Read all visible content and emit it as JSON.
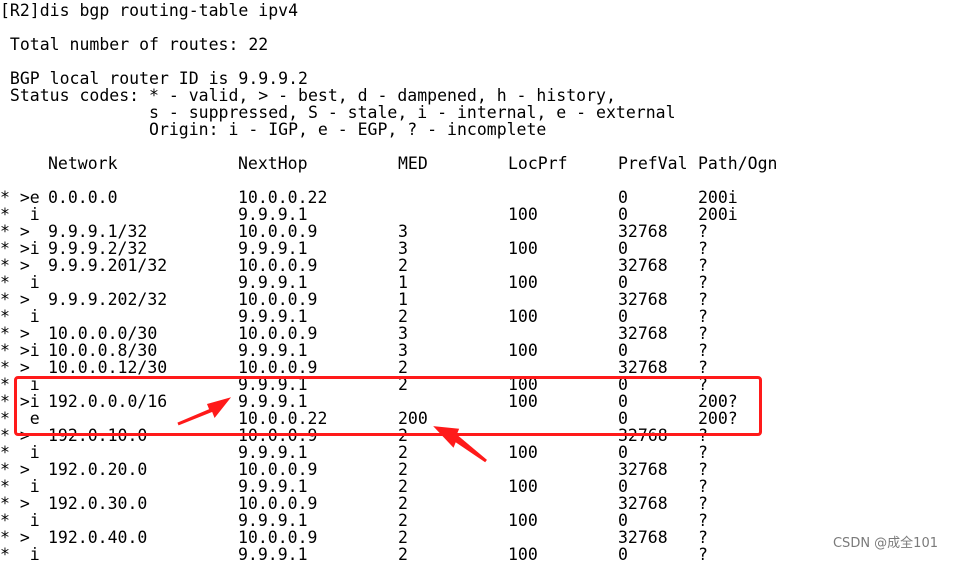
{
  "command": "[R2]dis bgp routing-table ipv4",
  "total_routes": " Total number of routes: 22",
  "router_id": " BGP local router ID is 9.9.9.2",
  "status_codes": [
    " Status codes: * - valid, > - best, d - dampened, h - history,",
    "               s - suppressed, S - stale, i - internal, e - external",
    "               Origin: i - IGP, e - EGP, ? - incomplete"
  ],
  "columns": [
    "Network",
    "NextHop",
    "MED",
    "LocPrf",
    "PrefVal",
    "Path/Ogn"
  ],
  "rows": [
    {
      "status": "* >e",
      "network": "0.0.0.0",
      "nexthop": "10.0.0.22",
      "med": "",
      "locprf": "",
      "prefval": "0",
      "path": "200i"
    },
    {
      "status": "*  i",
      "network": "",
      "nexthop": "9.9.9.1",
      "med": "",
      "locprf": "100",
      "prefval": "0",
      "path": "200i"
    },
    {
      "status": "* >",
      "network": "9.9.9.1/32",
      "nexthop": "10.0.0.9",
      "med": "3",
      "locprf": "",
      "prefval": "32768",
      "path": "?"
    },
    {
      "status": "* >i",
      "network": "9.9.9.2/32",
      "nexthop": "9.9.9.1",
      "med": "3",
      "locprf": "100",
      "prefval": "0",
      "path": "?"
    },
    {
      "status": "* >",
      "network": "9.9.9.201/32",
      "nexthop": "10.0.0.9",
      "med": "2",
      "locprf": "",
      "prefval": "32768",
      "path": "?"
    },
    {
      "status": "*  i",
      "network": "",
      "nexthop": "9.9.9.1",
      "med": "1",
      "locprf": "100",
      "prefval": "0",
      "path": "?"
    },
    {
      "status": "* >",
      "network": "9.9.9.202/32",
      "nexthop": "10.0.0.9",
      "med": "1",
      "locprf": "",
      "prefval": "32768",
      "path": "?"
    },
    {
      "status": "*  i",
      "network": "",
      "nexthop": "9.9.9.1",
      "med": "2",
      "locprf": "100",
      "prefval": "0",
      "path": "?"
    },
    {
      "status": "* >",
      "network": "10.0.0.0/30",
      "nexthop": "10.0.0.9",
      "med": "3",
      "locprf": "",
      "prefval": "32768",
      "path": "?"
    },
    {
      "status": "* >i",
      "network": "10.0.0.8/30",
      "nexthop": "9.9.9.1",
      "med": "3",
      "locprf": "100",
      "prefval": "0",
      "path": "?"
    },
    {
      "status": "* >",
      "network": "10.0.0.12/30",
      "nexthop": "10.0.0.9",
      "med": "2",
      "locprf": "",
      "prefval": "32768",
      "path": "?"
    },
    {
      "status": "*  i",
      "network": "",
      "nexthop": "9.9.9.1",
      "med": "2",
      "locprf": "100",
      "prefval": "0",
      "path": "?"
    },
    {
      "status": "* >i",
      "network": "192.0.0.0/16",
      "nexthop": "9.9.9.1",
      "med": "",
      "locprf": "100",
      "prefval": "0",
      "path": "200?"
    },
    {
      "status": "*  e",
      "network": "",
      "nexthop": "10.0.0.22",
      "med": "200",
      "locprf": "",
      "prefval": "0",
      "path": "200?"
    },
    {
      "status": "* >",
      "network": "192.0.10.0",
      "nexthop": "10.0.0.9",
      "med": "2",
      "locprf": "",
      "prefval": "32768",
      "path": "?"
    },
    {
      "status": "*  i",
      "network": "",
      "nexthop": "9.9.9.1",
      "med": "2",
      "locprf": "100",
      "prefval": "0",
      "path": "?"
    },
    {
      "status": "* >",
      "network": "192.0.20.0",
      "nexthop": "10.0.0.9",
      "med": "2",
      "locprf": "",
      "prefval": "32768",
      "path": "?"
    },
    {
      "status": "*  i",
      "network": "",
      "nexthop": "9.9.9.1",
      "med": "2",
      "locprf": "100",
      "prefval": "0",
      "path": "?"
    },
    {
      "status": "* >",
      "network": "192.0.30.0",
      "nexthop": "10.0.0.9",
      "med": "2",
      "locprf": "",
      "prefval": "32768",
      "path": "?"
    },
    {
      "status": "*  i",
      "network": "",
      "nexthop": "9.9.9.1",
      "med": "2",
      "locprf": "100",
      "prefval": "0",
      "path": "?"
    },
    {
      "status": "* >",
      "network": "192.0.40.0",
      "nexthop": "10.0.0.9",
      "med": "2",
      "locprf": "",
      "prefval": "32768",
      "path": "?"
    },
    {
      "status": "*  i",
      "network": "",
      "nexthop": "9.9.9.1",
      "med": "2",
      "locprf": "100",
      "prefval": "0",
      "path": "?"
    }
  ],
  "annotation": {
    "box_color": "#ff1a1a",
    "arrow_color": "#ff1a1a"
  },
  "watermark": "CSDN @成全101"
}
